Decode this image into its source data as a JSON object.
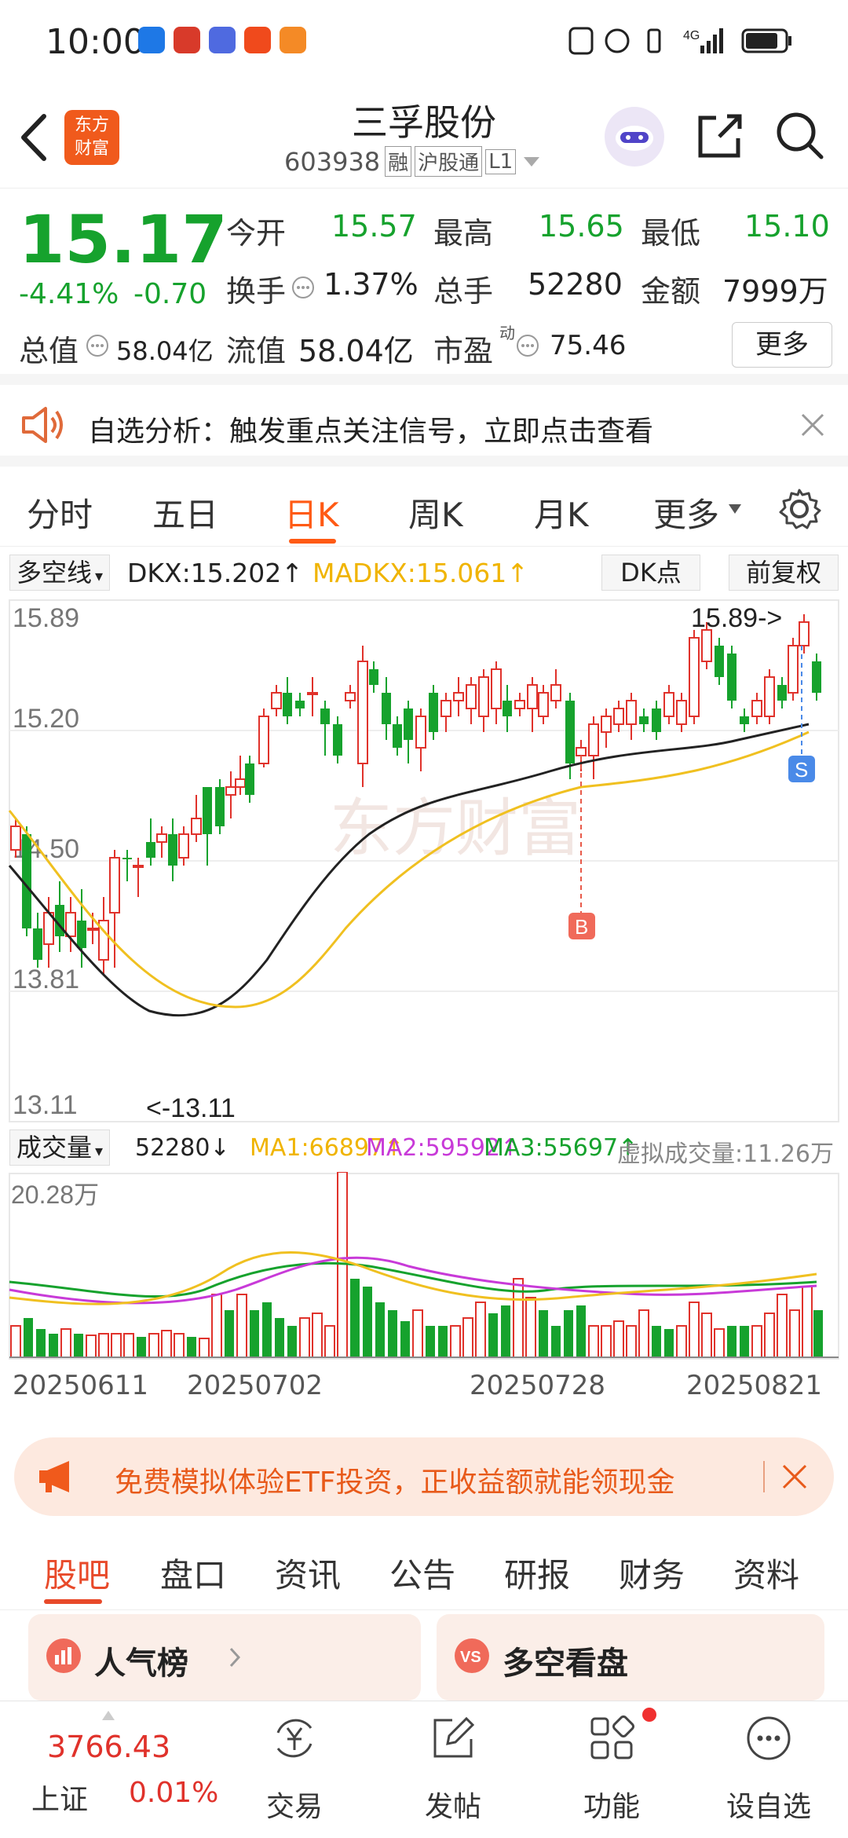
{
  "status": {
    "time": "10:00",
    "net": "4G"
  },
  "header": {
    "title": "三孚股份",
    "code": "603938",
    "badges": [
      "融",
      "沪股通",
      "L1"
    ],
    "logo_text_1": "东方",
    "logo_text_2": "财富"
  },
  "quote": {
    "price": "15.17",
    "pct": "-4.41%",
    "chg": "-0.70",
    "open_label": "今开",
    "open": "15.57",
    "high_label": "最高",
    "high": "15.65",
    "low_label": "最低",
    "low": "15.10",
    "turnover_label": "换手",
    "turnover": "1.37%",
    "vol_label": "总手",
    "vol": "52280",
    "amount_label": "金额",
    "amount": "7999万",
    "mcap_label": "总值",
    "mcap": "58.04亿",
    "float_label": "流值",
    "float": "58.04亿",
    "pe_label": "市盈",
    "pe_sup": "动",
    "pe": "75.46",
    "more": "更多"
  },
  "banner": {
    "text": "自选分析：触发重点关注信号，立即点击查看"
  },
  "tabs": [
    "分时",
    "五日",
    "日K",
    "周K",
    "月K",
    "更多"
  ],
  "active_tab": "日K",
  "indicator": {
    "name": "多空线",
    "dkx": "DKX:15.202↑",
    "madkx": "MADKX:15.061↑",
    "dk_btn": "DK点",
    "adj_btn": "前复权"
  },
  "chart_axis": {
    "p1": "15.89",
    "p2": "15.20",
    "p3": "14.50",
    "p4": "13.81",
    "p5": "13.11",
    "max_label": "15.89->",
    "min_label": "<-13.11",
    "b_mark": "B",
    "s_mark": "S",
    "watermark": "东方财富"
  },
  "volume": {
    "name": "成交量",
    "v": "52280↓",
    "ma1": "MA1:66897↑",
    "ma2": "MA2:59592↑",
    "ma3": "MA3:55697↑",
    "virt": "虚拟成交量:11.26万",
    "max": "20.28万"
  },
  "dates": [
    "20250611",
    "20250702",
    "20250728",
    "20250821"
  ],
  "promo": {
    "text": "免费模拟体验ETF投资，正收益额就能领现金"
  },
  "bottom_tabs": [
    "股吧",
    "盘口",
    "资讯",
    "公告",
    "研报",
    "财务",
    "资料"
  ],
  "cards": {
    "left": "人气榜",
    "right": "多空看盘"
  },
  "nav": {
    "index_value": "3766.43",
    "index_name": "上证",
    "index_pct": "0.01%",
    "trade": "交易",
    "post": "发帖",
    "func": "功能",
    "watch": "设自选"
  },
  "colors": {
    "up": "#e0322b",
    "down": "#16a22d",
    "accent": "#ff6a1a",
    "dkx": "#222222",
    "madkx": "#f0c020"
  }
}
